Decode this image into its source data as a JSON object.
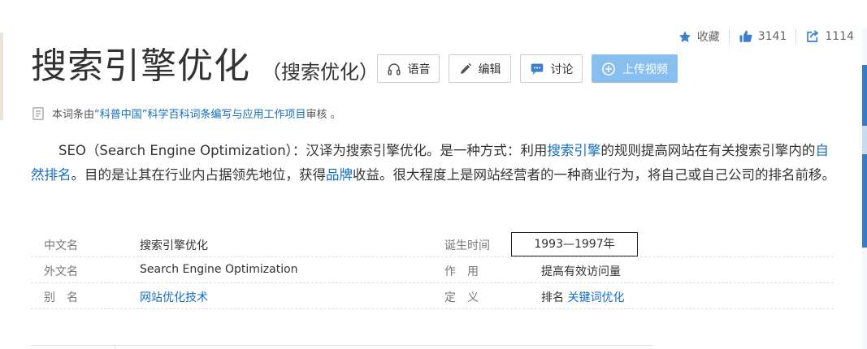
{
  "stats": {
    "favorite_label": "收藏",
    "like_count": "3141",
    "share_count": "1114"
  },
  "entry": {
    "title": "搜索引擎优化",
    "subtitle": "（搜索优化）"
  },
  "actions": {
    "voice": "语音",
    "edit": "编辑",
    "discuss": "讨论",
    "upload_video": "上传视频"
  },
  "source": {
    "prefix": "本词条由",
    "link": "“科普中国”科学百科词条编写与应用工作项目",
    "suffix": " 审核 。"
  },
  "summary": {
    "part1": "SEO（Search Engine Optimization）：汉译为搜索引擎优化。是一种方式：利用",
    "link1": "搜索引擎",
    "part2": "的规则提高网站在有关搜索引擎内的",
    "link2": "自然排名",
    "part3": "。目的是让其在行业内占据领先地位，获得",
    "link3": "品牌",
    "part4": "收益。很大程度上是网站经营者的一种商业行为，将自己或自己公司的排名前移。"
  },
  "info": {
    "rows": [
      {
        "label_left": "中文名",
        "value_left": "搜索引擎优化",
        "label_right": "诞生时间",
        "value_right": "1993—1997年"
      },
      {
        "label_left": "外文名",
        "value_left": "Search Engine Optimization",
        "label_right": "作　用",
        "value_right": "提高有效访问量"
      },
      {
        "label_left": "别　名",
        "value_left": "网站优化技术",
        "label_right": "定　义",
        "value_right_prefix": "排名 ",
        "value_right_link": "关键词优化"
      }
    ]
  },
  "colors": {
    "link": "#136ec2",
    "upload_button": "#88bfef",
    "icon_blue": "#3a7fd0"
  },
  "icons": [
    "star-icon",
    "thumbs-up-icon",
    "share-icon",
    "headphones-icon",
    "pencil-icon",
    "comment-icon",
    "plus-circle-icon",
    "document-icon"
  ]
}
